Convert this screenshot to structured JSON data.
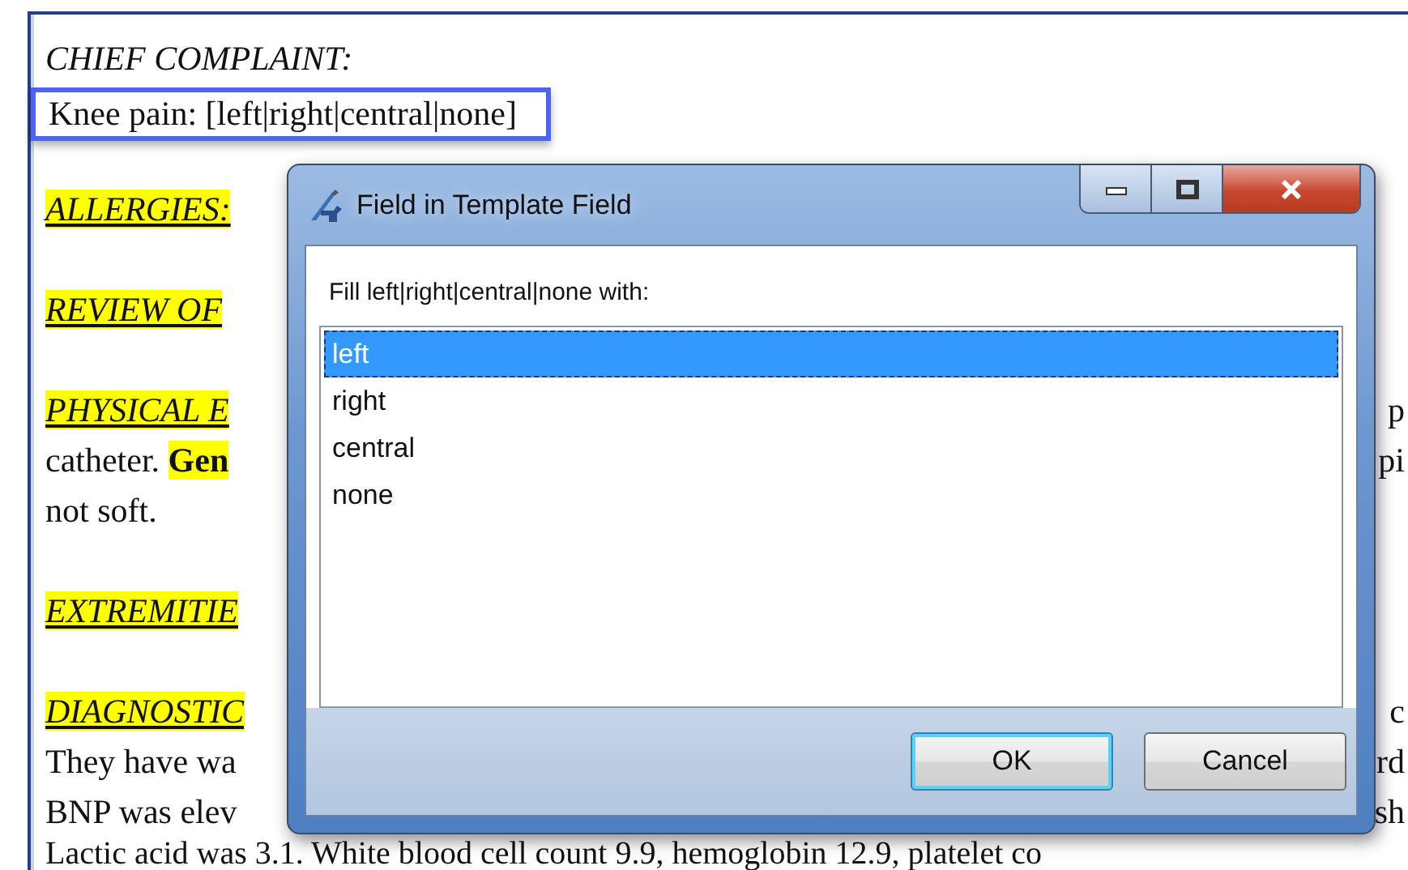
{
  "document": {
    "lines": [
      {
        "kind": "label",
        "segments": [
          {
            "text": "CHIEF COMPLAINT:",
            "highlight": false,
            "bold": false
          }
        ]
      },
      {
        "kind": "field",
        "selected": true,
        "segments": [
          {
            "text": "Knee pain:  [left|right|central|none]",
            "highlight": false,
            "bold": false
          }
        ]
      },
      {
        "kind": "heading",
        "segments": [
          {
            "text": "ALLERGIES:",
            "highlight": true,
            "bold": false
          }
        ]
      },
      {
        "kind": "heading",
        "segments": [
          {
            "text": "REVIEW OF",
            "highlight": true,
            "bold": false
          }
        ]
      },
      {
        "kind": "heading",
        "segments": [
          {
            "text": "PHYSICAL E",
            "highlight": true,
            "bold": false
          }
        ],
        "right": "p"
      },
      {
        "kind": "text",
        "segments": [
          {
            "text": "catheter. ",
            "highlight": false,
            "bold": false
          },
          {
            "text": "Gen",
            "highlight": true,
            "bold": true
          }
        ],
        "right": "pi"
      },
      {
        "kind": "text",
        "segments": [
          {
            "text": "not soft.",
            "highlight": false,
            "bold": false
          }
        ]
      },
      {
        "kind": "heading",
        "segments": [
          {
            "text": "EXTREMITIE",
            "highlight": true,
            "bold": false
          }
        ]
      },
      {
        "kind": "heading",
        "segments": [
          {
            "text": "DIAGNOSTIC",
            "highlight": true,
            "bold": false
          }
        ],
        "right": "c"
      },
      {
        "kind": "text",
        "segments": [
          {
            "text": "They have wa",
            "highlight": false,
            "bold": false
          }
        ],
        "right": "rd"
      },
      {
        "kind": "text",
        "segments": [
          {
            "text": "BNP was elev",
            "highlight": false,
            "bold": false
          }
        ],
        "right": "sh"
      },
      {
        "kind": "text",
        "segments": [
          {
            "text": "Lactic acid was 3.1.  White blood cell count 9.9, hemoglobin 12.9, platelet co",
            "highlight": false,
            "bold": false
          }
        ]
      }
    ]
  },
  "dialog": {
    "title": "Field in Template Field",
    "prompt": "Fill left|right|central|none with:",
    "options": [
      {
        "label": "left",
        "selected": true
      },
      {
        "label": "right",
        "selected": false
      },
      {
        "label": "central",
        "selected": false
      },
      {
        "label": "none",
        "selected": false
      }
    ],
    "buttons": [
      {
        "label": "OK",
        "kind": "default"
      },
      {
        "label": "Cancel",
        "kind": "normal"
      }
    ]
  }
}
